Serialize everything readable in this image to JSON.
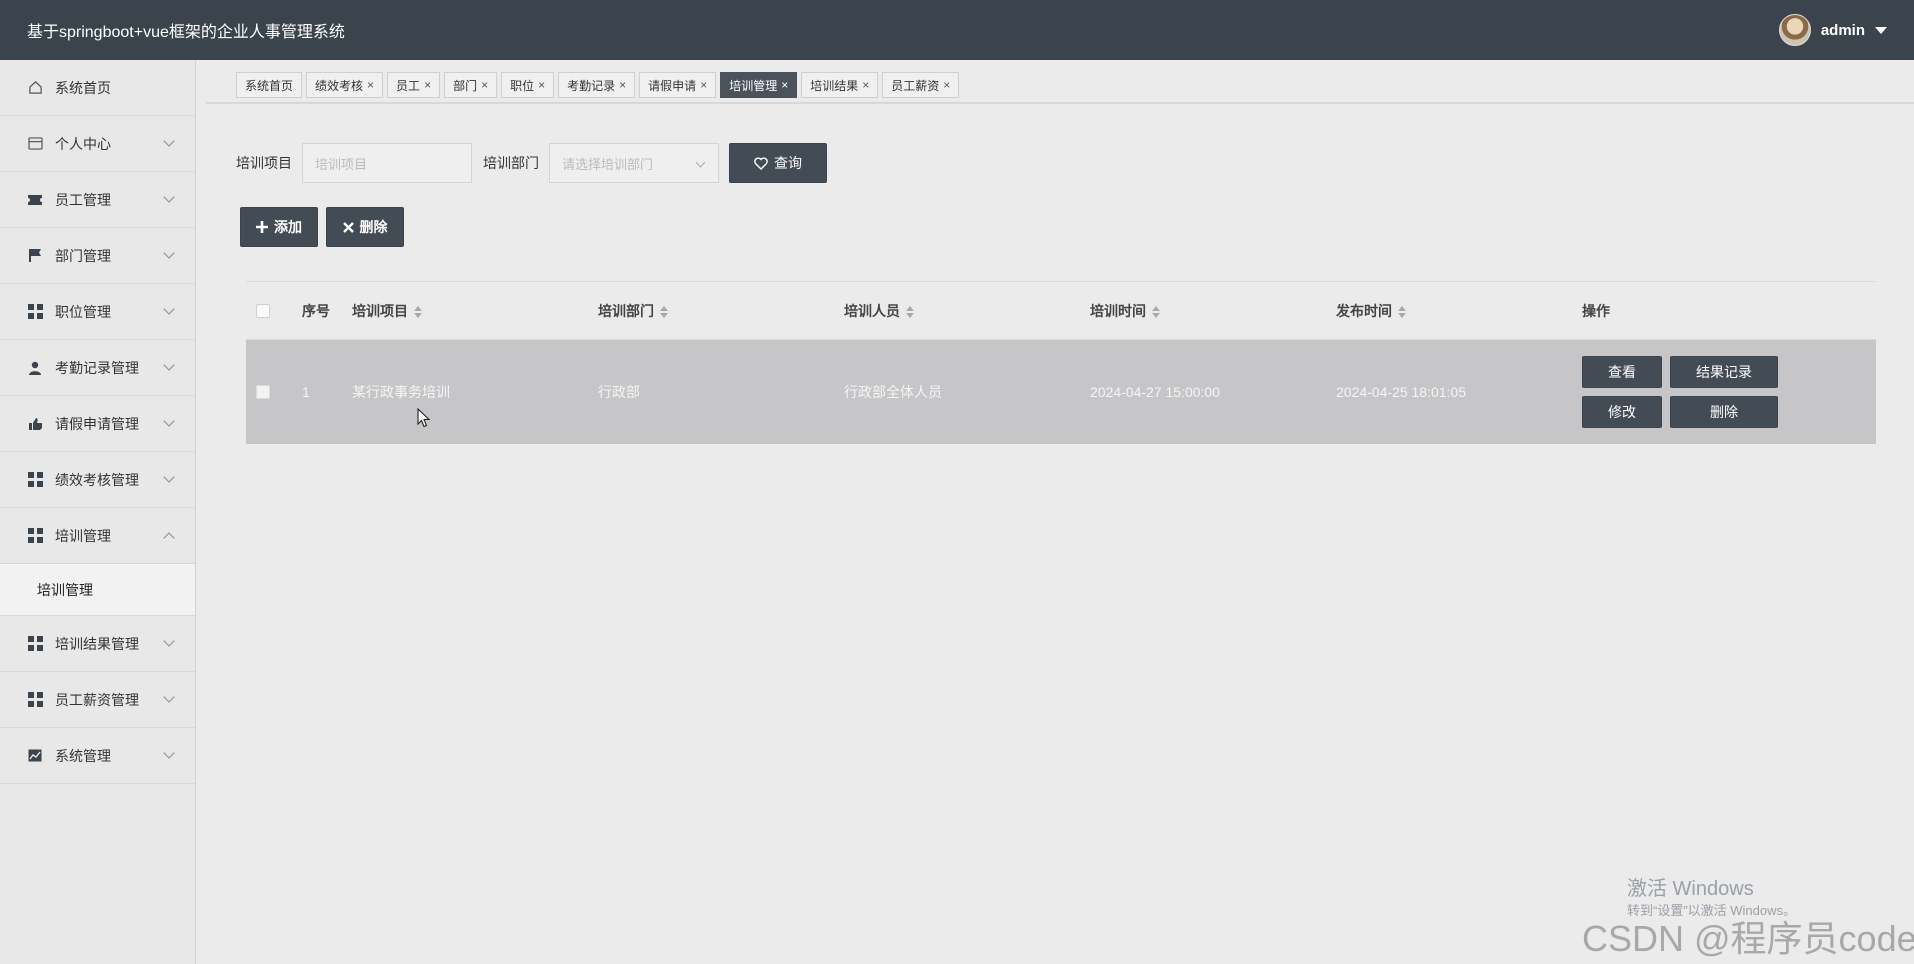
{
  "app": {
    "title": "基于springboot+vue框架的企业人事管理系统",
    "user": "admin"
  },
  "sidebar": {
    "items": [
      {
        "label": "系统首页",
        "icon": "home-icon",
        "expandable": false
      },
      {
        "label": "个人中心",
        "icon": "id-card-icon",
        "expandable": true
      },
      {
        "label": "员工管理",
        "icon": "ticket-icon",
        "expandable": true
      },
      {
        "label": "部门管理",
        "icon": "flag-icon",
        "expandable": true
      },
      {
        "label": "职位管理",
        "icon": "grid-icon",
        "expandable": true
      },
      {
        "label": "考勤记录管理",
        "icon": "user-icon",
        "expandable": true
      },
      {
        "label": "请假申请管理",
        "icon": "thumbs-up-icon",
        "expandable": true
      },
      {
        "label": "绩效考核管理",
        "icon": "grid-icon",
        "expandable": true
      },
      {
        "label": "培训管理",
        "icon": "grid-icon",
        "expandable": true,
        "expanded": true
      },
      {
        "label": "培训结果管理",
        "icon": "grid-icon",
        "expandable": true
      },
      {
        "label": "员工薪资管理",
        "icon": "grid-icon",
        "expandable": true
      },
      {
        "label": "系统管理",
        "icon": "chart-icon",
        "expandable": true
      }
    ],
    "submenu": {
      "label": "培训管理"
    }
  },
  "tabs": [
    {
      "label": "系统首页",
      "closable": false
    },
    {
      "label": "绩效考核",
      "closable": true
    },
    {
      "label": "员工",
      "closable": true
    },
    {
      "label": "部门",
      "closable": true
    },
    {
      "label": "职位",
      "closable": true
    },
    {
      "label": "考勤记录",
      "closable": true
    },
    {
      "label": "请假申请",
      "closable": true
    },
    {
      "label": "培训管理",
      "closable": true,
      "active": true
    },
    {
      "label": "培训结果",
      "closable": true
    },
    {
      "label": "员工薪资",
      "closable": true
    }
  ],
  "search": {
    "project_label": "培训项目",
    "project_placeholder": "培训项目",
    "dept_label": "培训部门",
    "dept_placeholder": "请选择培训部门",
    "query_label": "查询"
  },
  "actions": {
    "add_label": "添加",
    "delete_label": "删除"
  },
  "table": {
    "headers": [
      "序号",
      "培训项目",
      "培训部门",
      "培训人员",
      "培训时间",
      "发布时间",
      "操作"
    ],
    "rows": [
      {
        "index": "1",
        "project": "某行政事务培训",
        "dept": "行政部",
        "staff": "行政部全体人员",
        "train_time": "2024-04-27 15:00:00",
        "publish_time": "2024-04-25 18:01:05",
        "ops": [
          "查看",
          "结果记录",
          "修改",
          "删除"
        ]
      }
    ]
  },
  "watermarks": {
    "windows_title": "激活 Windows",
    "windows_sub": "转到“设置”以激活 Windows。",
    "csdn": "CSDN @程序员code"
  },
  "colors": {
    "topbar": "#3b434d",
    "button": "#434b55",
    "selected_row": "#c6c6c9"
  },
  "close_glyph": "×"
}
